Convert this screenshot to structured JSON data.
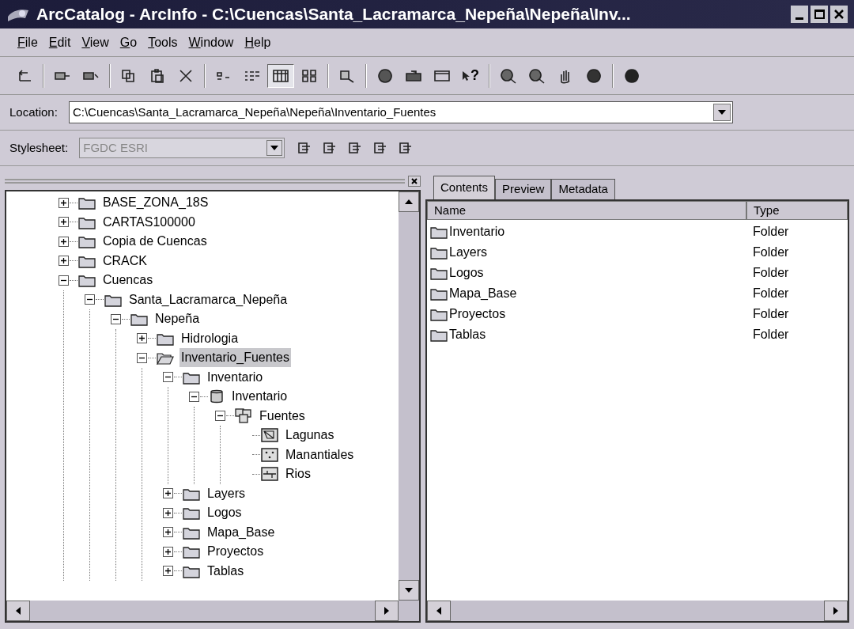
{
  "window": {
    "title": "ArcCatalog - ArcInfo - C:\\Cuencas\\Santa_Lacramarca_Nepeña\\Nepeña\\Inv..."
  },
  "menu": [
    "File",
    "Edit",
    "View",
    "Go",
    "Tools",
    "Window",
    "Help"
  ],
  "help_button": {
    "label": "?"
  },
  "view_buttons": [
    {
      "kind": "large-icons",
      "selected": false
    },
    {
      "kind": "list",
      "selected": false
    },
    {
      "kind": "details",
      "selected": true
    },
    {
      "kind": "thumbnails",
      "selected": false
    }
  ],
  "location": {
    "label": "Location:",
    "value": "C:\\Cuencas\\Santa_Lacramarca_Nepeña\\Nepeña\\Inventario_Fuentes"
  },
  "stylesheet": {
    "label": "Stylesheet:",
    "value": "FGDC ESRI",
    "disabled": true
  },
  "tree": [
    {
      "label": "BASE_ZONA_18S",
      "kind": "folder",
      "expanded": false,
      "selected": false
    },
    {
      "label": "CARTAS100000",
      "kind": "folder",
      "expanded": false,
      "selected": false
    },
    {
      "label": "Copia de Cuencas",
      "kind": "folder",
      "expanded": false,
      "selected": false
    },
    {
      "label": "CRACK",
      "kind": "folder",
      "expanded": false,
      "selected": false
    },
    {
      "label": "Cuencas",
      "kind": "folder",
      "expanded": true,
      "selected": false,
      "children": [
        {
          "label": "Santa_Lacramarca_Nepeña",
          "kind": "folder",
          "expanded": true,
          "selected": false,
          "children": [
            {
              "label": "Nepeña",
              "kind": "folder",
              "expanded": true,
              "selected": false,
              "children": [
                {
                  "label": "Hidrologia",
                  "kind": "folder",
                  "expanded": false,
                  "selected": false
                },
                {
                  "label": "Inventario_Fuentes",
                  "kind": "folder",
                  "expanded": true,
                  "selected": true,
                  "children": [
                    {
                      "label": "Inventario",
                      "kind": "folder",
                      "expanded": true,
                      "selected": false,
                      "children": [
                        {
                          "label": "Inventario",
                          "kind": "geodatabase",
                          "expanded": true,
                          "selected": false,
                          "children": [
                            {
                              "label": "Fuentes",
                              "kind": "dataset",
                              "expanded": true,
                              "selected": false,
                              "children": [
                                {
                                  "label": "Lagunas",
                                  "kind": "polygon",
                                  "selected": false
                                },
                                {
                                  "label": "Manantiales",
                                  "kind": "point",
                                  "selected": false
                                },
                                {
                                  "label": "Rios",
                                  "kind": "line",
                                  "selected": false
                                }
                              ]
                            }
                          ]
                        }
                      ]
                    },
                    {
                      "label": "Layers",
                      "kind": "folder",
                      "expanded": false,
                      "selected": false
                    },
                    {
                      "label": "Logos",
                      "kind": "folder",
                      "expanded": false,
                      "selected": false
                    },
                    {
                      "label": "Mapa_Base",
                      "kind": "folder",
                      "expanded": false,
                      "selected": false
                    },
                    {
                      "label": "Proyectos",
                      "kind": "folder",
                      "expanded": false,
                      "selected": false
                    },
                    {
                      "label": "Tablas",
                      "kind": "folder",
                      "expanded": false,
                      "selected": false
                    }
                  ]
                }
              ]
            }
          ]
        }
      ]
    }
  ],
  "tabs": [
    {
      "label": "Contents",
      "selected": true
    },
    {
      "label": "Preview",
      "selected": false
    },
    {
      "label": "Metadata",
      "selected": false
    }
  ],
  "table": {
    "columns": [
      "Name",
      "Type"
    ],
    "rows": [
      [
        "Inventario",
        "Folder"
      ],
      [
        "Layers",
        "Folder"
      ],
      [
        "Logos",
        "Folder"
      ],
      [
        "Mapa_Base",
        "Folder"
      ],
      [
        "Proyectos",
        "Folder"
      ],
      [
        "Tablas",
        "Folder"
      ]
    ]
  }
}
